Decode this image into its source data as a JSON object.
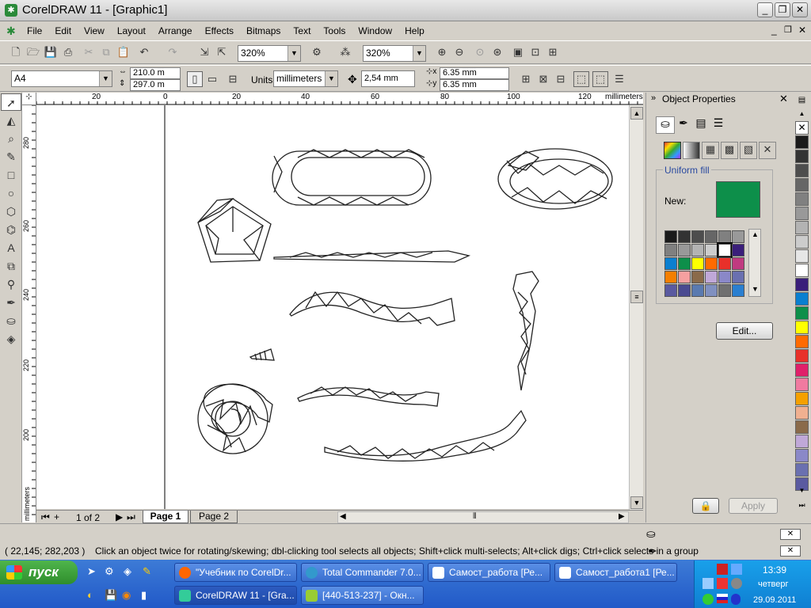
{
  "window": {
    "title": "CorelDRAW 11 - [Graphic1]"
  },
  "menu": [
    "File",
    "Edit",
    "View",
    "Layout",
    "Arrange",
    "Effects",
    "Bitmaps",
    "Text",
    "Tools",
    "Window",
    "Help"
  ],
  "toolbar": {
    "zoom1": "320%",
    "zoom2": "320%"
  },
  "property_bar": {
    "paper": "A4",
    "width": "210.0 m",
    "height": "297.0 m",
    "units_label": "Units:",
    "units": "millimeters",
    "nudge": "2,54 mm",
    "dup_x": "6.35 mm",
    "dup_y": "6.35 mm"
  },
  "ruler": {
    "h_ticks": [
      "20",
      "0",
      "20",
      "40",
      "60",
      "80",
      "100",
      "120"
    ],
    "h_unit": "millimeters",
    "v_ticks": [
      "280",
      "260",
      "240",
      "220",
      "200"
    ],
    "v_unit": "millimeters"
  },
  "pages": {
    "counter": "1 of 2",
    "tabs": [
      "Page 1",
      "Page 2"
    ]
  },
  "docker": {
    "title": "Object Properties",
    "section": "Uniform fill",
    "new_label": "New:",
    "new_color": "#0d8f4a",
    "edit": "Edit...",
    "apply": "Apply"
  },
  "status": {
    "coords": "( 22,145; 282,203 )",
    "message": "Click an object twice for rotating/skewing; dbl-clicking tool selects all objects; Shift+click multi-selects; Alt+click digs; Ctrl+click selects in a group"
  },
  "taskbar": {
    "start": "пуск",
    "row1": [
      "\"Учебник по CorelDr...",
      "Total Commander 7.0...",
      "Самост_работа [Ре...",
      "Самост_работа1 [Ре..."
    ],
    "row2": [
      "CorelDRAW 11 - [Gra...",
      "[440-513-237] - Окн..."
    ],
    "clock": "13:39",
    "day": "четверг",
    "date": "29.09.2011"
  },
  "palette_colors": [
    "#ffffff",
    "#1a1a1a",
    "#333333",
    "#4d4d4d",
    "#666666",
    "#808080",
    "#999999",
    "#b3b3b3",
    "#cccccc",
    "#e6e6e6",
    "#ffffff",
    "#3a1e7a",
    "#0a7fd0",
    "#0d8f4a",
    "#ffff00",
    "#ff6a00",
    "#e8302a",
    "#e0206a",
    "#f07aa0",
    "#f5a000",
    "#f0b090",
    "#8a6a4a",
    "#c0a8d8",
    "#8a88c8",
    "#6a70b0",
    "#5a5aa0"
  ],
  "docker_grid": [
    "#1a1a1a",
    "#333333",
    "#4d4d4d",
    "#666666",
    "#808080",
    "#999999",
    "#808080",
    "#999999",
    "#b3b3b3",
    "#cccccc",
    "#ffffff",
    "#3a1e7a",
    "#0a7fd0",
    "#0d8f4a",
    "#ffff00",
    "#ff6a00",
    "#e8302a",
    "#c03a80",
    "#f57f00",
    "#f5a0a0",
    "#8a6a4a",
    "#c0a8d8",
    "#8a88c8",
    "#6a70b0",
    "#5a5aa0",
    "#4a4a90",
    "#5a7ab0",
    "#8090c0",
    "#707070",
    "#2a7fd0"
  ]
}
